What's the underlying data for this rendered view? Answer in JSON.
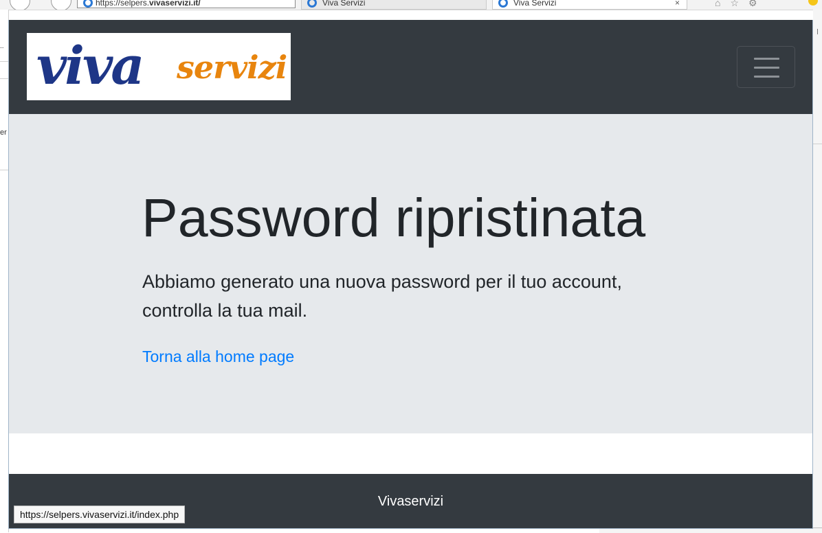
{
  "browser": {
    "address_prefix": "https://selpers.",
    "address_domain": "vivaservizi.it/",
    "tabs": [
      {
        "label": "Viva Servizi"
      },
      {
        "label": "Viva Servizi"
      }
    ],
    "tab_close": "×",
    "status_url": "https://selpers.vivaservizi.it/index.php"
  },
  "header": {
    "logo_word_1": "viva",
    "logo_word_2": "servizi",
    "menu_icon": "hamburger-menu-icon"
  },
  "main": {
    "title": "Password ripristinata",
    "message": "Abbiamo generato una nuova password per il tuo account, controlla la tua mail.",
    "link_label": "Torna alla home page"
  },
  "footer": {
    "text": "Vivaservizi"
  },
  "colors": {
    "navbar": "#343a40",
    "jumbotron": "#e6e9ec",
    "link": "#007bff",
    "logo_blue": "#1e3687",
    "logo_orange": "#e8850e"
  }
}
